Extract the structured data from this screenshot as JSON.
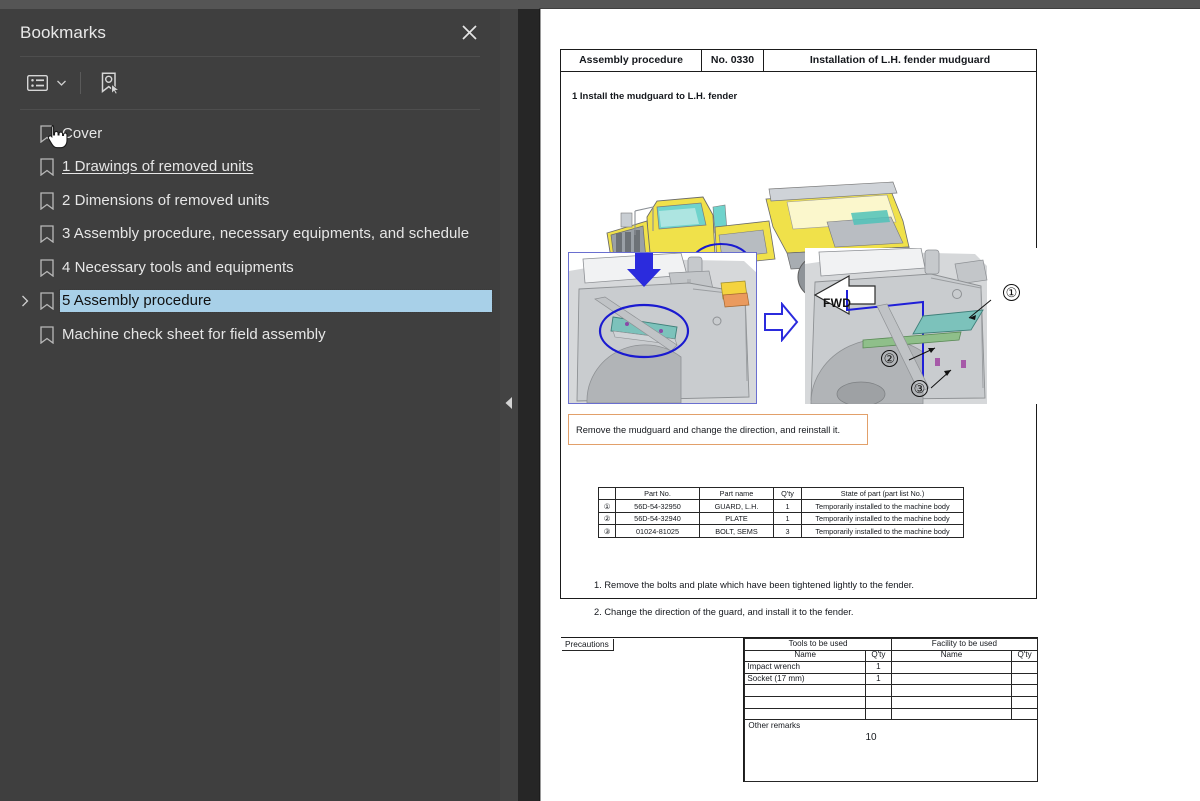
{
  "sidebar": {
    "title": "Bookmarks",
    "close_label": "×",
    "toolbar": {
      "options_label": "Bookmark options",
      "options_icon": "list-options-icon",
      "caret_icon": "chevron-down-icon",
      "new_bookmark_label": "New bookmark",
      "new_bookmark_icon": "bookmark-pointer-icon"
    },
    "items": [
      {
        "label": "Cover",
        "icon": "bookmark-icon",
        "selected": false,
        "underlined": false,
        "expandable": false
      },
      {
        "label": "1 Drawings of removed units",
        "icon": "bookmark-icon",
        "selected": false,
        "underlined": true,
        "expandable": false
      },
      {
        "label": "2 Dimensions of removed units",
        "icon": "bookmark-icon",
        "selected": false,
        "underlined": false,
        "expandable": false
      },
      {
        "label": "3 Assembly procedure, necessary equipments, and schedule",
        "icon": "bookmark-icon",
        "selected": false,
        "underlined": false,
        "expandable": false
      },
      {
        "label": "4 Necessary tools and equipments",
        "icon": "bookmark-icon",
        "selected": false,
        "underlined": false,
        "expandable": false
      },
      {
        "label": "5 Assembly procedure",
        "icon": "bookmark-icon",
        "selected": true,
        "underlined": false,
        "expandable": true
      },
      {
        "label": "Machine check sheet for field assembly",
        "icon": "bookmark-icon",
        "selected": false,
        "underlined": false,
        "expandable": false
      }
    ]
  },
  "divider": {
    "collapse_label": "Collapse panel",
    "collapse_icon": "triangle-left-icon"
  },
  "document": {
    "header": {
      "category": "Assembly procedure",
      "number": "No. 0330",
      "title": "Installation of L.H. fender mudguard"
    },
    "step_title": "1 Install the mudguard to L.H. fender",
    "figure": {
      "machine": "articulated dump truck illustration",
      "fwd_label": "FWD",
      "callouts": [
        "①",
        "②",
        "③"
      ]
    },
    "callout_note": "Remove the mudguard and change the direction, and reinstall it.",
    "parts_table": {
      "headers": [
        "",
        "Part No.",
        "Part name",
        "Q'ty",
        "State of part (part list No.)"
      ],
      "rows": [
        {
          "num": "①",
          "part_no": "56D-54-32950",
          "part_name": "GUARD, L.H.",
          "qty": "1",
          "state": "Temporarily installed to the machine body"
        },
        {
          "num": "②",
          "part_no": "56D-54-32940",
          "part_name": "PLATE",
          "qty": "1",
          "state": "Temporarily installed to the machine body"
        },
        {
          "num": "③",
          "part_no": "01024-81025",
          "part_name": "BOLT, SEMS",
          "qty": "3",
          "state": "Temporarily installed to the machine body"
        }
      ]
    },
    "steps": [
      "1. Remove the bolts and plate which have been tightened lightly to the fender.",
      "2. Change the direction of the guard, and install it to the fender."
    ],
    "bottom": {
      "precautions_label": "Precautions",
      "tools_header": "Tools to be used",
      "facility_header": "Facility to be used",
      "name_header": "Name",
      "qty_header": "Q'ty",
      "tools": [
        {
          "name": "Impact wrench",
          "qty": "1"
        },
        {
          "name": "Socket (17 mm)",
          "qty": "1"
        },
        {
          "name": "",
          "qty": ""
        },
        {
          "name": "",
          "qty": ""
        },
        {
          "name": "",
          "qty": ""
        }
      ],
      "facility": [
        {
          "name": "",
          "qty": ""
        },
        {
          "name": "",
          "qty": ""
        },
        {
          "name": "",
          "qty": ""
        },
        {
          "name": "",
          "qty": ""
        },
        {
          "name": "",
          "qty": ""
        }
      ],
      "other_remarks_label": "Other remarks"
    },
    "page_number": "10"
  },
  "colors": {
    "sidebar_bg": "#3f3f3f",
    "viewer_bg": "#262626",
    "selection": "#a8d0e8",
    "highlight_blue": "#1a1ad0",
    "callout_border": "#e2a06a",
    "machine_yellow": "#f2e03a",
    "part_teal": "#6fbfb5"
  }
}
